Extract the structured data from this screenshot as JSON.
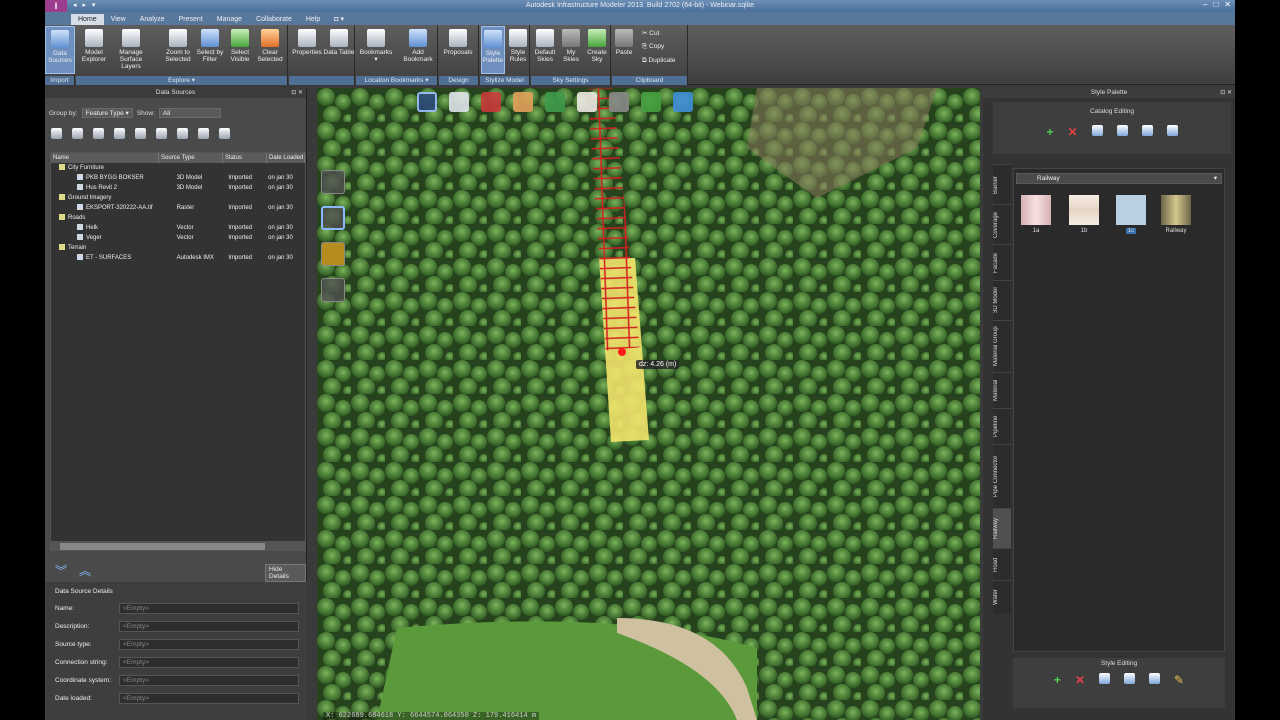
{
  "window": {
    "title": "Autodesk Infrastructure Modeler 2013. Build 2702 (64-bit) - Webinar.sqlite",
    "logo": "I",
    "qat": "◂ ▸ ▾",
    "controls": [
      "–",
      "□",
      "✕"
    ]
  },
  "menu": {
    "tabs": [
      "Home",
      "View",
      "Analyze",
      "Present",
      "Manage",
      "Collaborate",
      "Help",
      "◘ ▾"
    ],
    "active": "Home"
  },
  "ribbon": {
    "groups": [
      {
        "label": "Import",
        "buttons": [
          {
            "label": "Data Sources",
            "icon": "data-sources-icon",
            "active": true
          }
        ]
      },
      {
        "label": "Explore ▾",
        "buttons": [
          {
            "label": "Model Explorer",
            "icon": "model-explorer-icon"
          },
          {
            "label": "Manage Surface Layers",
            "icon": "surface-layers-icon"
          },
          {
            "label": "Zoom to Selected",
            "icon": "zoom-icon"
          },
          {
            "label": "Select by Filter",
            "icon": "filter-icon"
          },
          {
            "label": "Select Visible",
            "icon": "select-visible-icon"
          },
          {
            "label": "Clear Selected",
            "icon": "clear-selected-icon"
          }
        ]
      },
      {
        "label": "",
        "buttons": [
          {
            "label": "Properties",
            "icon": "properties-icon"
          },
          {
            "label": "Data Table",
            "icon": "data-table-icon"
          }
        ]
      },
      {
        "label": "Location Bookmarks ▾",
        "buttons": [
          {
            "label": "Bookmarks ▾",
            "icon": "bookmarks-icon"
          },
          {
            "label": "Add Bookmark",
            "icon": "add-bookmark-icon"
          }
        ]
      },
      {
        "label": "Design",
        "buttons": [
          {
            "label": "Proposals",
            "icon": "proposals-icon"
          }
        ]
      },
      {
        "label": "Stylize Model",
        "buttons": [
          {
            "label": "Style Palette",
            "icon": "style-palette-icon",
            "active": true
          },
          {
            "label": "Style Rules",
            "icon": "style-rules-icon"
          }
        ]
      },
      {
        "label": "Sky Settings",
        "buttons": [
          {
            "label": "Default Skies",
            "icon": "default-skies-icon"
          },
          {
            "label": "My Skies",
            "icon": "my-skies-icon"
          },
          {
            "label": "Create Sky",
            "icon": "create-sky-icon"
          }
        ]
      },
      {
        "label": "Clipboard",
        "buttons": [
          {
            "label": "Paste",
            "icon": "paste-icon"
          }
        ],
        "small": [
          "Cut",
          "Copy",
          "Duplicate"
        ]
      }
    ]
  },
  "datasources": {
    "title": "Data Sources",
    "groupby_label": "Group by:",
    "groupby_value": "Feature Type",
    "show_label": "Show:",
    "show_value": "All",
    "columns": [
      "Name",
      "Source Type",
      "Status",
      "Date Loaded"
    ],
    "rows": [
      {
        "name": "City Furniture",
        "type": "",
        "status": "",
        "date": "",
        "folder": true
      },
      {
        "name": "PKB BYGG BOKSER",
        "type": "3D Model",
        "status": "Imported",
        "date": "on jan 30"
      },
      {
        "name": "Hus Revit 2",
        "type": "3D Model",
        "status": "Imported",
        "date": "on jan 30"
      },
      {
        "name": "Ground Imagery",
        "type": "",
        "status": "",
        "date": "",
        "folder": true
      },
      {
        "name": "EKSPORT-320222-AA.tif",
        "type": "Raster",
        "status": "Imported",
        "date": "on jan 30"
      },
      {
        "name": "Roads",
        "type": "",
        "status": "",
        "date": "",
        "folder": true
      },
      {
        "name": "Helk",
        "type": "Vector",
        "status": "Imported",
        "date": "on jan 30"
      },
      {
        "name": "Veger",
        "type": "Vector",
        "status": "Imported",
        "date": "on jan 30"
      },
      {
        "name": "Terrain",
        "type": "",
        "status": "",
        "date": "",
        "folder": true
      },
      {
        "name": "ET - SURFACES",
        "type": "Autodesk IMX",
        "status": "Imported",
        "date": "on jan 30"
      }
    ],
    "hide_details": "Hide Details",
    "details_title": "Data Source Details",
    "details": [
      {
        "label": "Name:",
        "value": "<Empty>"
      },
      {
        "label": "Description:",
        "value": "<Empty>"
      },
      {
        "label": "Source type:",
        "value": "<Empty>"
      },
      {
        "label": "Connection string:",
        "value": "<Empty>"
      },
      {
        "label": "Coordinate system:",
        "value": "<Empty>"
      },
      {
        "label": "Date loaded:",
        "value": "<Empty>"
      }
    ]
  },
  "viewport": {
    "measure": "dz: 4.26 (m)",
    "coords": "X: 622689.684618 Y: 6644574.064350 Z: 179.416414 m"
  },
  "palette": {
    "title": "Style Palette",
    "catalog_title": "Catalog Editing",
    "category": "Railway",
    "vtabs": [
      "Barrier",
      "Coverage",
      "Facade",
      "3D Model",
      "Material Group",
      "Material",
      "Pipeline",
      "Pipe Connector",
      "Railway",
      "Road",
      "Water"
    ],
    "active_tab": "Railway",
    "styles": [
      {
        "label": "1a",
        "color": "#f1d6d6"
      },
      {
        "label": "1b",
        "color": "#f4e9dc"
      },
      {
        "label": "1c",
        "color": "#b8d0e2"
      },
      {
        "label": "Railway",
        "color": "#b9ad7a"
      }
    ],
    "style_editing": "Style Editing"
  }
}
